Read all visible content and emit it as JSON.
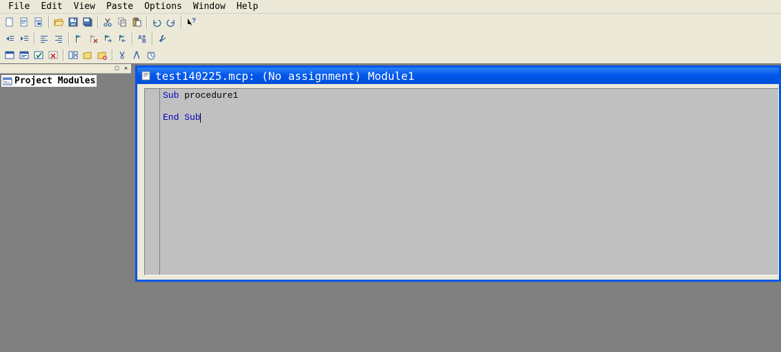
{
  "menu": {
    "file": "File",
    "edit": "Edit",
    "view": "View",
    "paste": "Paste",
    "options": "Options",
    "window": "Window",
    "help": "Help"
  },
  "toolbar_icons": {
    "new": "new-file",
    "open1": "open-file",
    "open2": "open-file",
    "browse": "folder-open",
    "save": "save",
    "saveall": "save-all",
    "cut": "cut",
    "copy": "copy",
    "paste": "paste",
    "undo": "undo",
    "redo": "redo",
    "help": "context-help",
    "indent": "indent",
    "outdent": "outdent",
    "align1": "align",
    "align2": "align",
    "flag_add": "bookmark-add",
    "flag_rem": "bookmark-remove",
    "flag_next": "bookmark-next",
    "flag_prev": "bookmark-prev",
    "replace": "replace",
    "tool": "wrench",
    "module1": "module-1",
    "module2": "module-2",
    "module3": "module-3",
    "module4": "module-4",
    "layout1": "layout",
    "folder_open": "folder-open",
    "folder_add": "folder-add",
    "compass": "compass",
    "divider": "dividers",
    "clock": "clock"
  },
  "project": {
    "root": "Project Modules"
  },
  "document": {
    "title": "test140225.mcp: (No assignment) Module1",
    "code": {
      "line1_kw": "Sub",
      "line1_rest": " procedure1",
      "line3_kw": "End Sub"
    }
  },
  "panel_header": {
    "minimize": "□",
    "close": "×"
  }
}
